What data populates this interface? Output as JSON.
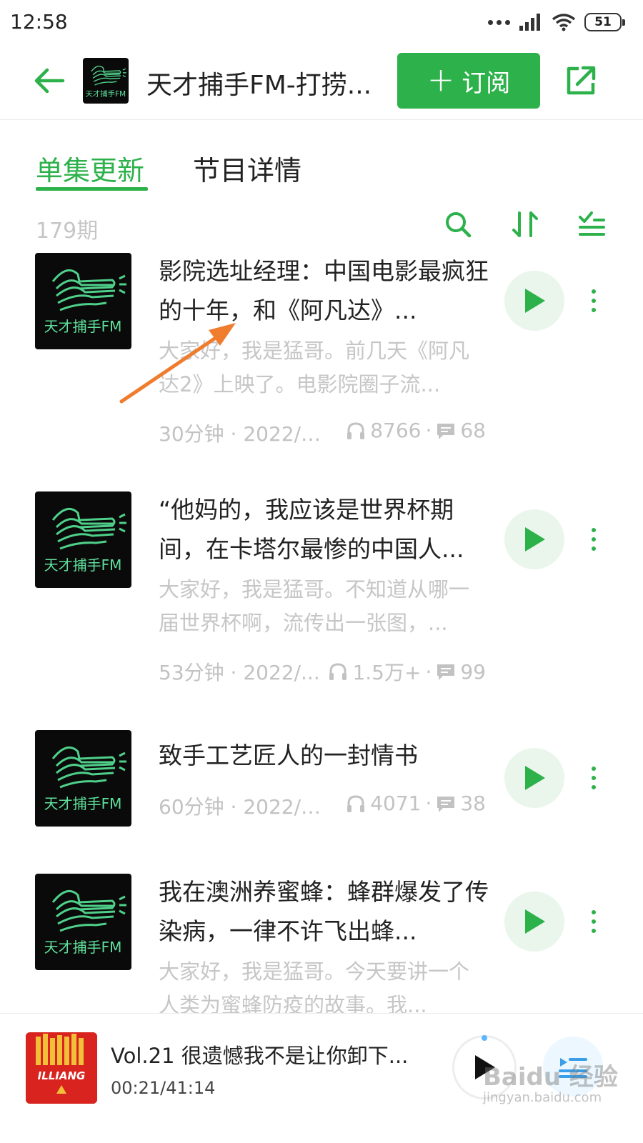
{
  "status_bar": {
    "time": "12:58",
    "battery": "51"
  },
  "header": {
    "title": "天才捕手FM-打捞...",
    "logo_text": "天才捕手FM",
    "subscribe_label": "订阅",
    "subscribe_plus": "+"
  },
  "tabs": [
    {
      "label": "单集更新",
      "active": true
    },
    {
      "label": "节目详情",
      "active": false
    }
  ],
  "list": {
    "count": "179期"
  },
  "episodes": [
    {
      "cover_text": "天才捕手FM",
      "title": "影院选址经理：中国电影最疯狂的十年，和《阿凡达》...",
      "desc": "大家好，我是猛哥。前几天《阿凡达2》上映了。电影院圈子流...",
      "duration_date": "30分钟 · 2022/1...",
      "plays": "8766",
      "comments": "68"
    },
    {
      "cover_text": "天才捕手FM",
      "title": "“他妈的，我应该是世界杯期间，在卡塔尔最惨的中国人...",
      "desc": "大家好，我是猛哥。不知道从哪一届世界杯啊，流传出一张图，...",
      "duration_date": "53分钟 · 2022/...",
      "plays": "1.5万+",
      "comments": "99"
    },
    {
      "cover_text": "天才捕手FM",
      "title": "致手工艺匠人的一封情书",
      "desc": "",
      "duration_date": "60分钟 · 2022/1...",
      "plays": "4071",
      "comments": "38"
    },
    {
      "cover_text": "天才捕手FM",
      "title": "我在澳洲养蜜蜂：蜂群爆发了传染病，一律不许飞出蜂...",
      "desc": "大家好，我是猛哥。今天要讲一个人类为蜜蜂防疫的故事。我...",
      "duration_date": "",
      "plays": "",
      "comments": ""
    }
  ],
  "mini_player": {
    "title": "Vol.21 很遗憾我不是让你卸下...",
    "time": "00:21/41:14",
    "cover_text": "ILLIANG"
  },
  "watermark": {
    "main": "Baidu 经验",
    "sub": "jingyan.baidu.com"
  },
  "colors": {
    "accent": "#2db14a",
    "muted_text": "#c6c6c6",
    "annotation_arrow": "#f07c2e"
  }
}
